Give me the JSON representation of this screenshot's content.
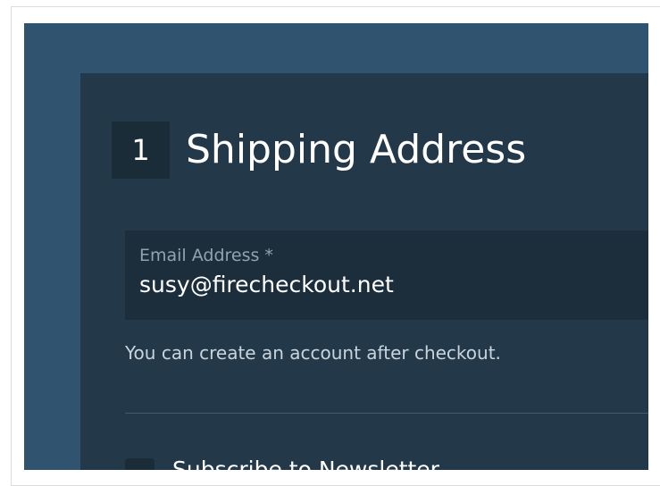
{
  "step": {
    "number": "1",
    "title": "Shipping Address"
  },
  "email": {
    "label": "Email Address",
    "required_marker": "*",
    "value": "susy@firecheckout.net"
  },
  "hint": "You can create an account after checkout.",
  "newsletter": {
    "label": "Subscribe to Newsletter",
    "checked": false
  },
  "colors": {
    "page_background": "#ffffff",
    "outer_panel": "#30546f",
    "inner_panel": "#23394a",
    "field_background": "#1c2e3c",
    "label_text": "#8fa3b1",
    "text_primary": "#ffffff"
  }
}
